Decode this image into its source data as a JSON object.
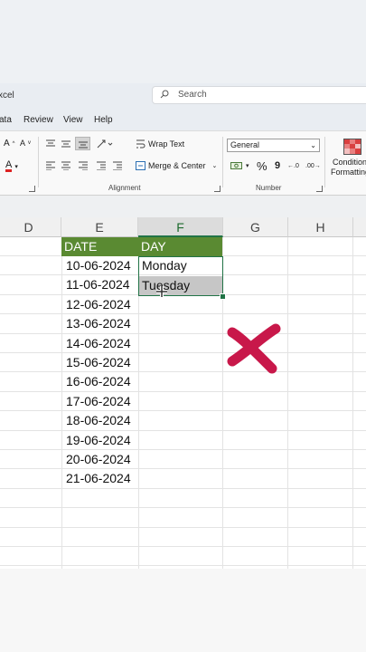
{
  "app": {
    "title_fragment": "xcel"
  },
  "search": {
    "placeholder": "Search"
  },
  "menu": [
    "ata",
    "Review",
    "View",
    "Help"
  ],
  "ribbon": {
    "wrap_text": "Wrap Text",
    "merge_center": "Merge & Center",
    "number_format": "General",
    "percent": "%",
    "comma": "9",
    "conditional_formatting_line1": "Condition",
    "conditional_formatting_line2": "Formatting",
    "group_alignment": "Alignment",
    "group_number": "Number"
  },
  "columns": [
    "D",
    "E",
    "F",
    "G",
    "H"
  ],
  "selected_column": "F",
  "table": {
    "headers": {
      "date": "DATE",
      "day": "DAY"
    },
    "dates": [
      "10-06-2024",
      "11-06-2024",
      "12-06-2024",
      "13-06-2024",
      "14-06-2024",
      "15-06-2024",
      "16-06-2024",
      "17-06-2024",
      "18-06-2024",
      "19-06-2024",
      "20-06-2024",
      "21-06-2024"
    ],
    "days": [
      "Monday",
      "Tuesday"
    ]
  },
  "colors": {
    "header_green": "#5a8a32",
    "excel_green": "#217346",
    "cross_mark": "#c8184a"
  },
  "overlay": {
    "mark": "cross-mark-icon"
  }
}
